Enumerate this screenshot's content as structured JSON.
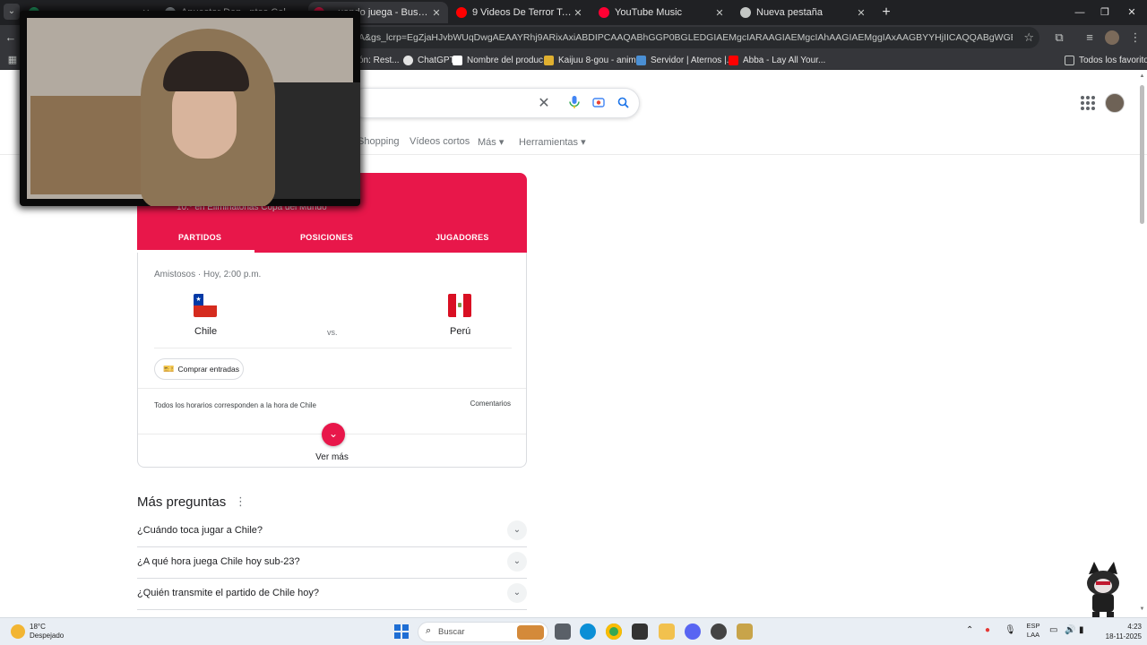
{
  "browser": {
    "tabs": [
      {
        "label": "",
        "active": false,
        "icon": "excel-icon",
        "color": "#21a366"
      },
      {
        "label": "Anuestor Dep...ntos Colle...",
        "active": false,
        "icon": "site-icon",
        "color": "#9aa0a6"
      },
      {
        "label": "...uando juega - Buscar con",
        "active": true,
        "icon": "google-icon",
        "color": "#e8174a"
      },
      {
        "label": "9 Videos De Terror Tan Maldito:",
        "active": false,
        "icon": "youtube-icon",
        "color": "#ff0000"
      },
      {
        "label": "YouTube Music",
        "active": false,
        "icon": "youtube-music-icon",
        "color": "#ff0033"
      },
      {
        "label": "Nueva pestaña",
        "active": false,
        "icon": "chrome-icon",
        "color": "#c4c7c5"
      }
    ],
    "url": "A&gs_lcrp=EgZjaHJvbWUqDwgAEAAYRhj9ARixAxiABDIPCAAQABhGGP0BGLEDGIAEMgcIARAAGIAEMgcIAhAAGIAEMggIAxAAGBYYHjIICAQQABgWGB4yCAgFEAAYFhgeMggIBh...",
    "bookmarks": [
      {
        "label": "ón: Rest...",
        "color": "#9aa0a6"
      },
      {
        "label": "ChatGPT",
        "color": "#e3e3e3"
      },
      {
        "label": "Nombre del produc...",
        "color": "#ffffff"
      },
      {
        "label": "Kaijuu 8-gou - anim...",
        "color": "#e0b030"
      },
      {
        "label": "Servidor | Aternos |...",
        "color": "#4a8fd4"
      },
      {
        "label": "Abba - Lay All Your...",
        "color": "#ff0000"
      }
    ],
    "all_bookmarks": "Todos los favoritos"
  },
  "google": {
    "nav": [
      "Shopping",
      "Vídeos cortos",
      "Más ▾",
      "Herramientas ▾"
    ],
    "team_card": {
      "subtitle": "10.º en Eliminatorias Copa del Mundo",
      "tabs": [
        "PARTIDOS",
        "POSICIONES",
        "JUGADORES"
      ],
      "match_meta": "Amistosos · Hoy, 2:00 p.m.",
      "home": "Chile",
      "away": "Perú",
      "vs": "vs.",
      "tickets": "Comprar entradas",
      "timezone_note": "Todos los horarios corresponden a la hora de Chile",
      "comments": "Comentarios",
      "more": "Ver más",
      "accent": "#e8174a"
    },
    "paa": {
      "title": "Más preguntas",
      "questions": [
        "¿Cuándo toca jugar a Chile?",
        "¿A qué hora juega Chile hoy sub-23?",
        "¿Quién transmite el partido de Chile hoy?"
      ]
    }
  },
  "taskbar": {
    "weather_temp": "18°C",
    "weather_desc": "Despejado",
    "search_placeholder": "Buscar",
    "lang_top": "ESP",
    "lang_bottom": "LAA",
    "time": "4:23",
    "date": "18-11-2025"
  }
}
